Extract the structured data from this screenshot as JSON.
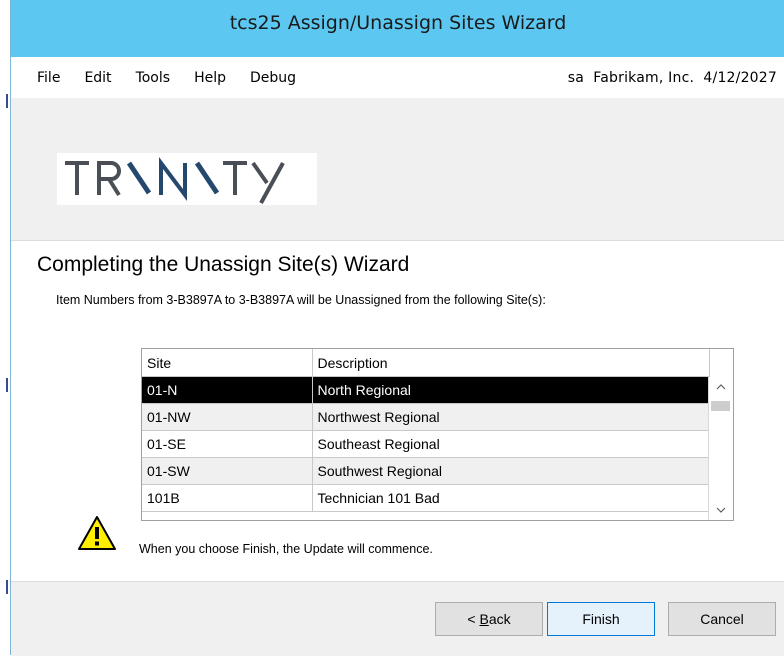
{
  "window": {
    "title": "tcs25 Assign/Unassign Sites Wizard"
  },
  "menu": {
    "items": [
      "File",
      "Edit",
      "Tools",
      "Help",
      "Debug"
    ],
    "status": "sa  Fabrikam, Inc.  4/12/2027"
  },
  "logo": {
    "text": "TRINITY"
  },
  "wizard": {
    "heading": "Completing the Unassign Site(s) Wizard",
    "description": "Item Numbers from 3-B3897A to 3-B3897A will be Unassigned from the following Site(s):",
    "columns": [
      "Site",
      "Description"
    ],
    "rows": [
      {
        "site": "01-N",
        "description": "North Regional"
      },
      {
        "site": "01-NW",
        "description": "Northwest Regional"
      },
      {
        "site": "01-SE",
        "description": "Southeast Regional"
      },
      {
        "site": "01-SW",
        "description": "Southwest Regional"
      },
      {
        "site": "101B",
        "description": "Technician 101 Bad"
      }
    ],
    "warning": "When you choose Finish, the Update will commence.",
    "warning_icon": "warning-icon"
  },
  "buttons": {
    "back_prefix": "< ",
    "back_key": "B",
    "back_rest": "ack",
    "finish": "Finish",
    "cancel": "Cancel"
  },
  "colors": {
    "titlebar": "#5cc8f2",
    "selection": "#000000",
    "warning": "#ffee00"
  }
}
